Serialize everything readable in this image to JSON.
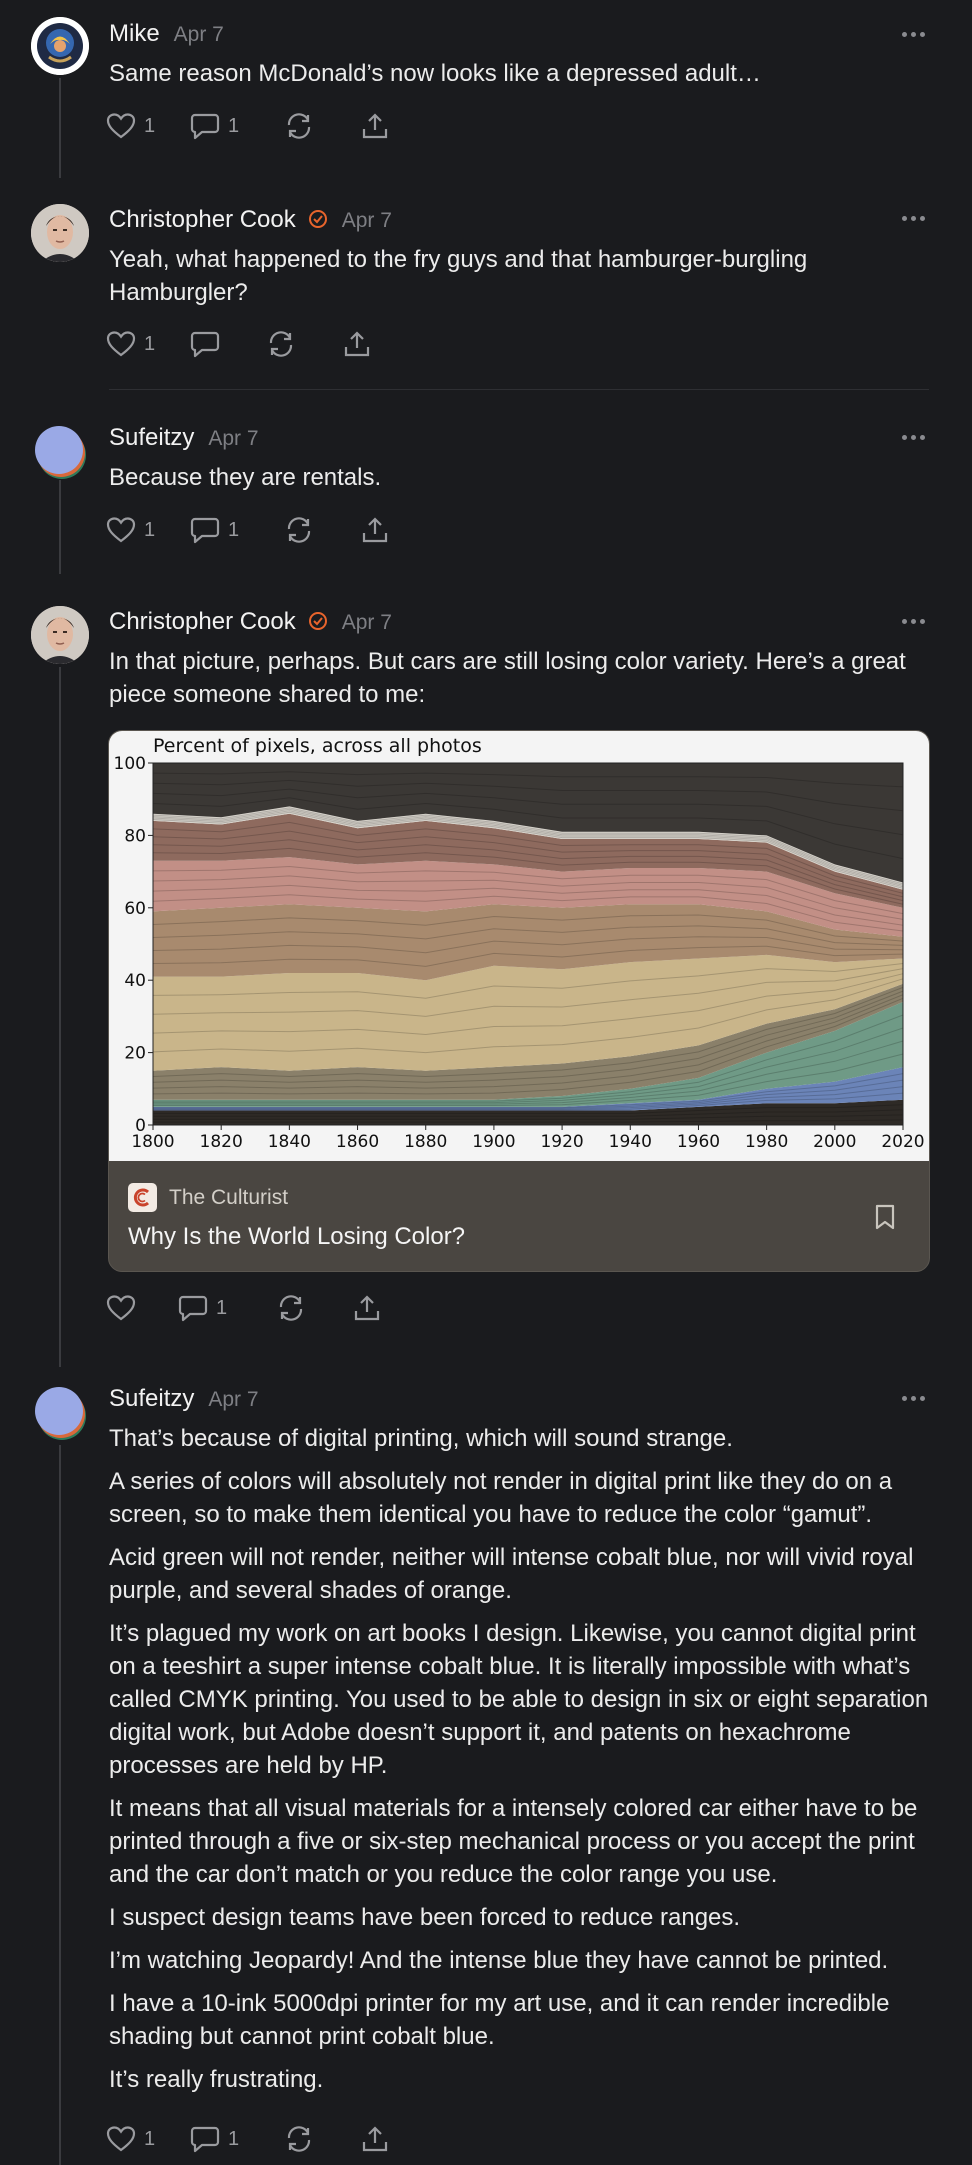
{
  "posts": [
    {
      "author": "Mike",
      "date": "Apr 7",
      "verified": false,
      "avatar": "avatar-mike",
      "paragraphs": [
        "Same reason McDonald’s now looks like a depressed adult…"
      ],
      "actions": {
        "likes": "1",
        "replies": "1"
      }
    },
    {
      "author": "Christopher Cook",
      "date": "Apr 7",
      "verified": true,
      "avatar": "avatar-christopher",
      "paragraphs": [
        "Yeah, what happened to the fry guys and that hamburger-burgling Hamburgler?"
      ],
      "actions": {
        "likes": "1",
        "replies": ""
      }
    },
    {
      "author": "Sufeitzy",
      "date": "Apr 7",
      "verified": false,
      "avatar": "avatar-sufeitzy",
      "paragraphs": [
        "Because they are rentals."
      ],
      "actions": {
        "likes": "1",
        "replies": "1"
      }
    },
    {
      "author": "Christopher Cook",
      "date": "Apr 7",
      "verified": true,
      "avatar": "avatar-christopher",
      "paragraphs": [
        "In that picture, perhaps. But cars are still losing color variety. Here’s a great piece someone shared to me:"
      ],
      "link_card": {
        "source": "The Culturist",
        "title": "Why Is the World Losing Color?"
      },
      "actions": {
        "likes": "",
        "replies": "1"
      }
    },
    {
      "author": "Sufeitzy",
      "date": "Apr 7",
      "verified": false,
      "avatar": "avatar-sufeitzy",
      "paragraphs": [
        "That’s because of digital printing, which will sound strange.",
        "A series of colors will absolutely not render in digital print like they do on a screen, so to make them identical you have to reduce the color “gamut”.",
        "Acid green will not render, neither will intense cobalt blue, nor will vivid royal purple, and several shades of orange.",
        "It’s plagued my work on art books I design. Likewise, you cannot digital print on a teeshirt a super intense cobalt blue. It is literally impossible with what’s called CMYK printing. You used to be able to design in six or eight separation digital work, but Adobe doesn’t support it, and patents on hexachrome processes are held by HP.",
        "It means that all visual materials for a intensely colored car either have to be printed through a five or six-step mechanical process or you accept the print and the car don’t match or you reduce the color range you use.",
        "I suspect design teams have been forced to reduce ranges.",
        "I’m watching Jeopardy! And the intense blue they have cannot be printed.",
        "I have a 10-ink 5000dpi printer for my art use, and it can render incredible shading but cannot print cobalt blue.",
        "It’s really frustrating."
      ],
      "actions": {
        "likes": "1",
        "replies": "1"
      }
    }
  ],
  "icons": {
    "like": "heart-icon",
    "reply": "comment-icon",
    "repost": "repost-icon",
    "share": "share-icon",
    "more": "more-icon",
    "verified": "verified-check-icon",
    "bookmark": "bookmark-icon"
  },
  "colors": {
    "background": "#1a1b1e",
    "verified": "#e8642c",
    "card_footer": "#4a4641"
  },
  "chart_data": {
    "type": "area",
    "title": "Percent of pixels, across all photos",
    "x": [
      1800,
      1820,
      1840,
      1860,
      1880,
      1900,
      1920,
      1940,
      1960,
      1980,
      2000,
      2020
    ],
    "xticks": [
      "1800",
      "1820",
      "1840",
      "1860",
      "1880",
      "1900",
      "1920",
      "1940",
      "1960",
      "1980",
      "2000",
      "2020"
    ],
    "yticks": [
      "0",
      "20",
      "40",
      "60",
      "80",
      "100"
    ],
    "ylim": [
      0,
      100
    ],
    "series": [
      {
        "color": "#2e2a26",
        "values": [
          4,
          4,
          4,
          4,
          4,
          4,
          4,
          4,
          5,
          6,
          6,
          7
        ]
      },
      {
        "color": "#6b84b8",
        "values": [
          1,
          1,
          1,
          1,
          1,
          1,
          1,
          2,
          2,
          4,
          6,
          9
        ]
      },
      {
        "color": "#6f9a86",
        "values": [
          2,
          2,
          2,
          2,
          2,
          2,
          3,
          4,
          6,
          10,
          14,
          18
        ]
      },
      {
        "color": "#8a806a",
        "values": [
          8,
          9,
          8,
          9,
          8,
          9,
          9,
          9,
          9,
          8,
          6,
          5
        ]
      },
      {
        "color": "#c9b58a",
        "values": [
          26,
          25,
          27,
          26,
          25,
          28,
          26,
          26,
          24,
          19,
          13,
          7
        ]
      },
      {
        "color": "#a88a6e",
        "values": [
          18,
          19,
          19,
          18,
          19,
          17,
          17,
          16,
          15,
          12,
          9,
          6
        ]
      },
      {
        "color": "#c28f86",
        "values": [
          14,
          13,
          13,
          12,
          14,
          11,
          10,
          10,
          10,
          11,
          10,
          8
        ]
      },
      {
        "color": "#8e6a5e",
        "values": [
          11,
          10,
          12,
          10,
          11,
          10,
          9,
          8,
          8,
          8,
          6,
          5
        ]
      },
      {
        "color": "#d8d4cc",
        "values": [
          2,
          2,
          2,
          2,
          2,
          2,
          2,
          2,
          2,
          2,
          2,
          2
        ]
      },
      {
        "color": "#3b3835",
        "values": [
          14,
          15,
          12,
          16,
          14,
          16,
          19,
          19,
          19,
          20,
          28,
          33
        ]
      }
    ]
  }
}
